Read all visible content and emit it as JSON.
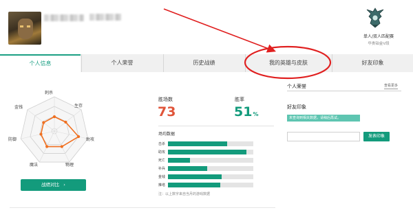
{
  "rank": {
    "title": "单人/双人匹配赛",
    "subtitle": "华贵铂金V段"
  },
  "tabs": [
    {
      "label": "个人信息",
      "active": true
    },
    {
      "label": "个人荣誉",
      "active": false
    },
    {
      "label": "历史战绩",
      "active": false
    },
    {
      "label": "我的英雄与皮肤",
      "active": false,
      "highlighted": true
    },
    {
      "label": "好友印象",
      "active": false
    }
  ],
  "radar": {
    "axes": [
      "刺杀",
      "生存",
      "助攻",
      "物理",
      "魔法",
      "防御",
      "金钱"
    ],
    "values": [
      0.42,
      0.42,
      0.72,
      0.5,
      0.5,
      0.4,
      0.4
    ],
    "compare_button": "战绩对比",
    "compare_chevron": "›"
  },
  "stats": {
    "wins_label": "胜场数",
    "wins": "73",
    "winrate_label": "胜率",
    "winrate": "51",
    "winrate_unit": "%",
    "wins_color": "#e0553a",
    "winrate_color": "#139b7c"
  },
  "per_game": {
    "title": "场均数据",
    "rows": [
      {
        "label": "击杀",
        "value": 0.69
      },
      {
        "label": "助攻",
        "value": 0.92
      },
      {
        "label": "死亡",
        "value": 0.26
      },
      {
        "label": "补兵",
        "value": 0.46
      },
      {
        "label": "金钱",
        "value": 0.63
      },
      {
        "label": "推塔",
        "value": 0.61
      }
    ],
    "note": "注：以上数字来自当月的游戏数据"
  },
  "honor": {
    "title": "个人荣誉",
    "view_more": "查看更多"
  },
  "impression": {
    "title": "好友印象",
    "notice": "未查询到相关数据，请稍后再试。",
    "input_placeholder": "",
    "post_button": "发表印象"
  },
  "colors": {
    "accent": "#139b7c",
    "annotation": "#e02020"
  },
  "icons": {
    "emblem": "rank-emblem-icon",
    "chevron": "chevron-right-icon",
    "avatar": "champion-portrait"
  }
}
